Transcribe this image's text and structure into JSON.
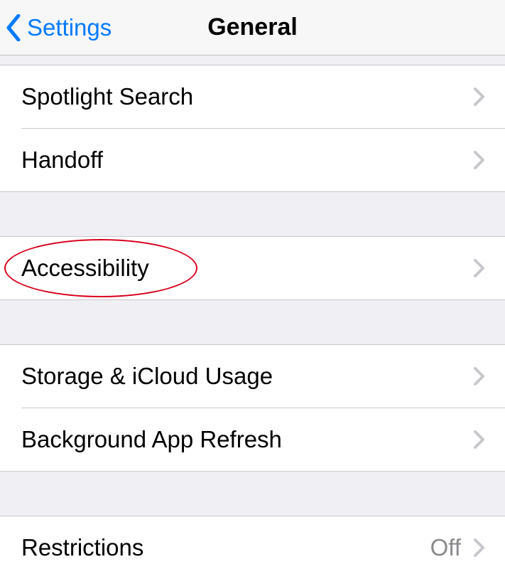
{
  "nav": {
    "back_label": "Settings",
    "title": "General"
  },
  "rows": {
    "spotlight": "Spotlight Search",
    "handoff": "Handoff",
    "accessibility": "Accessibility",
    "storage": "Storage & iCloud Usage",
    "background_refresh": "Background App Refresh",
    "restrictions": "Restrictions",
    "restrictions_value": "Off"
  }
}
